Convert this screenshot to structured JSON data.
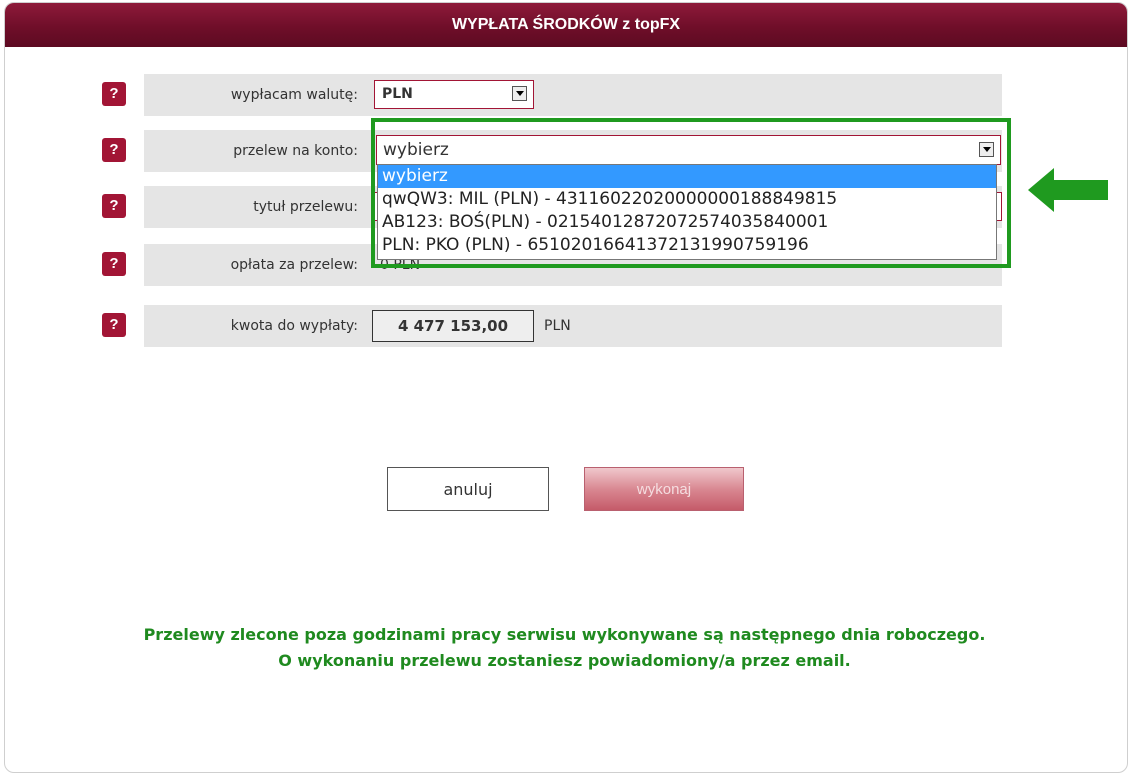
{
  "window": {
    "title": "WYPŁATA ŚRODKÓW z topFX"
  },
  "help_label": "?",
  "rows": {
    "currency": {
      "label": "wypłacam walutę:",
      "value": "PLN"
    },
    "account": {
      "label": "przelew na konto:",
      "value": "wybierz",
      "options": [
        "wybierz",
        "qwQW3: MIL (PLN) - 43116022020000000188849815",
        "AB123: BOŚ(PLN) - 02154012872072574035840001",
        "PLN: PKO (PLN) - 65102016641372131990759196"
      ],
      "selected_index": 0
    },
    "title": {
      "label": "tytuł przelewu:"
    },
    "fee": {
      "label": "opłata za przelew:",
      "value": "0 PLN"
    },
    "amount": {
      "label": "kwota do wypłaty:",
      "value": "4 477 153,00",
      "currency": "PLN"
    }
  },
  "buttons": {
    "cancel": "anuluj",
    "execute": "wykonaj"
  },
  "notice": {
    "line1": "Przelewy zlecone poza godzinami pracy serwisu wykonywane są następnego dnia roboczego.",
    "line2": "O wykonaniu przelewu zostaniesz powiadomiony/a przez email."
  },
  "colors": {
    "header": "#6f0e29",
    "help": "#a21535",
    "highlight": "#1f9a1f",
    "selected_option": "#3399ff"
  },
  "icons": {
    "dropdown": "chevron-down-icon",
    "annotation": "arrow-left-icon"
  }
}
